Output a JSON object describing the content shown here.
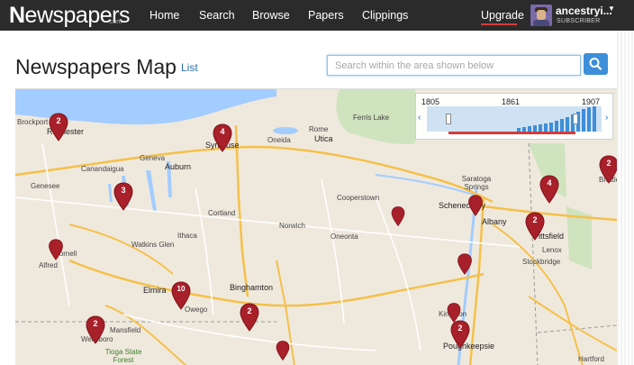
{
  "header": {
    "logo_text": "Newspapers",
    "logo_sub": ".com",
    "nav": [
      "Home",
      "Search",
      "Browse",
      "Papers",
      "Clippings"
    ],
    "upgrade": "Upgrade",
    "username": "ancestryi...",
    "user_role": "SUBSCRIBER"
  },
  "page": {
    "title": "Newspapers Map",
    "list_link": "List",
    "search_placeholder": "Search within the area shown below"
  },
  "timeline": {
    "start_year": "1805",
    "mid_year": "1861",
    "end_year": "1907"
  },
  "map": {
    "places": [
      "Brockport",
      "Rochester",
      "Genesee",
      "Alfred",
      "Hornell",
      "Canandaigua",
      "Geneva",
      "Auburn",
      "Syracuse",
      "Oneida",
      "Rome",
      "Utica",
      "Ferris Lake",
      "Saratoga Springs",
      "Schenectady",
      "Albany",
      "Cooperstown",
      "Norwich",
      "Oneonta",
      "Cortland",
      "Ithaca",
      "Watkins Glen",
      "Elmira",
      "Binghamton",
      "Owego",
      "Mansfield",
      "Wellsboro",
      "Tioga State Forest",
      "Kingston",
      "Poughkeepsie",
      "Pittsfield",
      "Lenox",
      "Stockbridge",
      "Hartford",
      "Brattleboro"
    ],
    "pins": [
      "2",
      "4",
      "3",
      "",
      "4",
      "",
      "2",
      "",
      "",
      "2",
      "2",
      "10",
      "2",
      "",
      "2"
    ]
  },
  "colors": {
    "nav_bg": "#2b2b2b",
    "pin": "#a8202a",
    "accent": "#3c8fd8"
  }
}
